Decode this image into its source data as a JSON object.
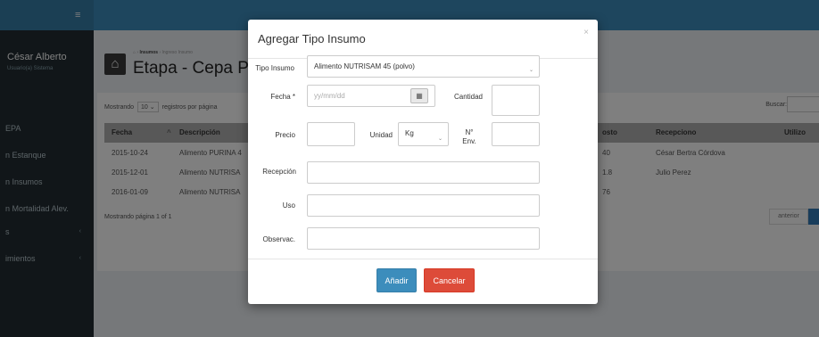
{
  "app": {
    "menu_icon": "hamburger-icon",
    "user": {
      "name": "César Alberto",
      "role": "Usuario(a) Sistema"
    },
    "sidebar": [
      {
        "label": "EPA"
      },
      {
        "label": "n Estanque"
      },
      {
        "label": "n Insumos"
      },
      {
        "label": "n Mortalidad Alev."
      },
      {
        "label": "s",
        "caret": "‹"
      },
      {
        "label": "imientos",
        "caret": "‹"
      }
    ],
    "breadcrumb": {
      "home": "⌂",
      "sep1": "›",
      "section": "Insumos",
      "sep2": "›",
      "current": "Ingreso Insumo"
    },
    "page_title": "Etapa - Cepa P",
    "table": {
      "length_prefix": "Mostrando",
      "length_value": "10",
      "length_suffix": "registros por página",
      "search_label": "Buscar:",
      "columns": [
        "Fecha",
        "Descripción",
        "osto",
        "Recepciono",
        "Utilizo"
      ],
      "rows": [
        {
          "fecha": "2015-10-24",
          "descripcion": "Alimento PURINA 4",
          "costo": "40",
          "recepciono": "César Bertra Córdova"
        },
        {
          "fecha": "2015-12-01",
          "descripcion": "Alimento NUTRISA",
          "costo": "1.8",
          "recepciono": "Julio Perez"
        },
        {
          "fecha": "2016-01-09",
          "descripcion": "Alimento NUTRISA",
          "costo": "76",
          "recepciono": ""
        }
      ],
      "info": "Mostrando página 1 of 1",
      "prev_label": "anterior"
    }
  },
  "modal": {
    "title": "Agregar Tipo Insumo",
    "close": "×",
    "fields": {
      "tipo_insumo": {
        "label": "Tipo Insumo",
        "value": "Alimento NUTRISAM 45 (polvo)"
      },
      "fecha": {
        "label": "Fecha *",
        "placeholder": "yy/mm/dd",
        "value": ""
      },
      "cantidad": {
        "label": "Cantidad",
        "value": ""
      },
      "precio": {
        "label": "Precio",
        "value": ""
      },
      "unidad": {
        "label": "Unidad",
        "value": "Kg"
      },
      "n_env": {
        "label_line1": "N°",
        "label_line2": "Env.",
        "value": ""
      },
      "recepcion": {
        "label": "Recepción",
        "value": ""
      },
      "uso": {
        "label": "Uso",
        "value": ""
      },
      "observac": {
        "label": "Observac.",
        "value": ""
      }
    },
    "buttons": {
      "add": "Añadir",
      "cancel": "Cancelar"
    },
    "colors": {
      "primary": "#3c8dbc",
      "danger": "#dd4b39",
      "header": "#3c8dbc",
      "sidebar": "#222d32"
    }
  }
}
